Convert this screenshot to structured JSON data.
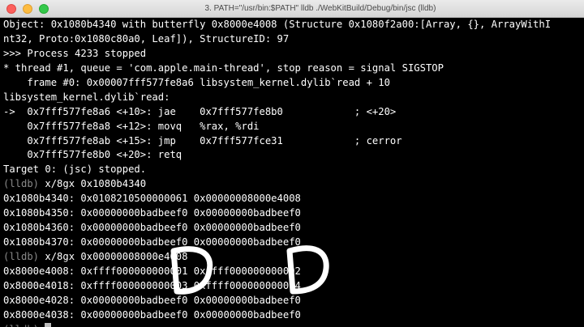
{
  "window": {
    "title": "3. PATH=\"/usr/bin:$PATH\" lldb ./WebKitBuild/Debug/bin/jsc (lldb)"
  },
  "terminal": {
    "lines": [
      {
        "prompt": "",
        "text": "Object: 0x1080b4340 with butterfly 0x8000e4008 (Structure 0x1080f2a00:[Array, {}, ArrayWithI"
      },
      {
        "prompt": "",
        "text": "nt32, Proto:0x1080c80a0, Leaf]), StructureID: 97"
      },
      {
        "prompt": "",
        "text": ">>> Process 4233 stopped"
      },
      {
        "prompt": "",
        "text": "* thread #1, queue = 'com.apple.main-thread', stop reason = signal SIGSTOP"
      },
      {
        "prompt": "",
        "text": "    frame #0: 0x00007fff577fe8a6 libsystem_kernel.dylib`read + 10"
      },
      {
        "prompt": "",
        "text": "libsystem_kernel.dylib`read:"
      },
      {
        "prompt": "",
        "text": "->  0x7fff577fe8a6 <+10>: jae    0x7fff577fe8b0            ; <+20>"
      },
      {
        "prompt": "",
        "text": "    0x7fff577fe8a8 <+12>: movq   %rax, %rdi"
      },
      {
        "prompt": "",
        "text": "    0x7fff577fe8ab <+15>: jmp    0x7fff577fce31            ; cerror"
      },
      {
        "prompt": "",
        "text": "    0x7fff577fe8b0 <+20>: retq"
      },
      {
        "prompt": "",
        "text": "Target 0: (jsc) stopped."
      },
      {
        "prompt": "(lldb)",
        "text": " x/8gx 0x1080b4340"
      },
      {
        "prompt": "",
        "text": "0x1080b4340: 0x0108210500000061 0x00000008000e4008"
      },
      {
        "prompt": "",
        "text": "0x1080b4350: 0x00000000badbeef0 0x00000000badbeef0"
      },
      {
        "prompt": "",
        "text": "0x1080b4360: 0x00000000badbeef0 0x00000000badbeef0"
      },
      {
        "prompt": "",
        "text": "0x1080b4370: 0x00000000badbeef0 0x00000000badbeef0"
      },
      {
        "prompt": "(lldb)",
        "text": " x/8gx 0x00000008000e4008"
      },
      {
        "prompt": "",
        "text": "0x8000e4008: 0xffff000000000001 0xffff000000000002"
      },
      {
        "prompt": "",
        "text": "0x8000e4018: 0xffff000000000003 0xffff000000000004"
      },
      {
        "prompt": "",
        "text": "0x8000e4028: 0x00000000badbeef0 0x00000000badbeef0"
      },
      {
        "prompt": "",
        "text": "0x8000e4038: 0x00000000badbeef0 0x00000000badbeef0"
      },
      {
        "prompt": "(lldb)",
        "text": " "
      }
    ]
  },
  "colors": {
    "background": "#000000",
    "text": "#ffffff",
    "prompt": "#8a8a8a",
    "annotation": "#ffffff"
  }
}
